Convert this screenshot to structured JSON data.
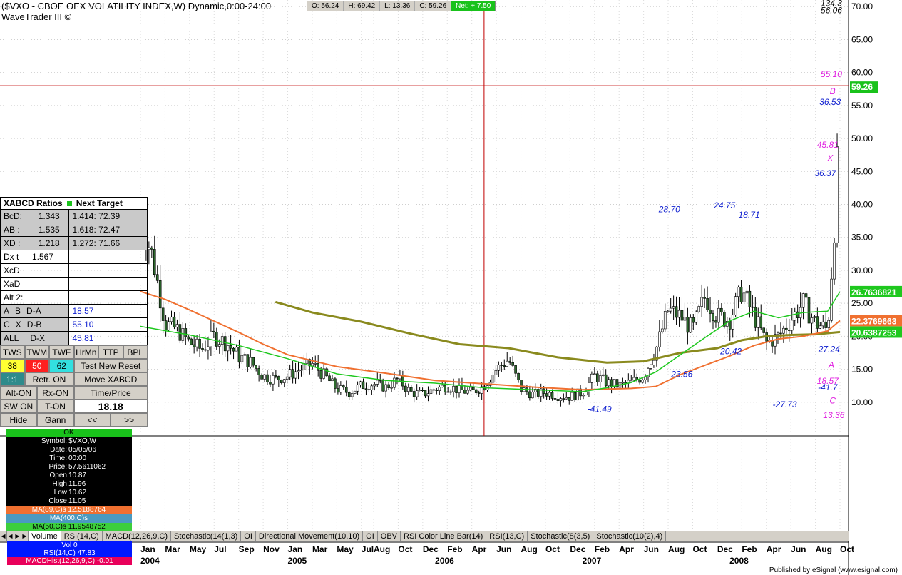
{
  "header": {
    "title": "($VXO - CBOE OEX VOLATILITY INDEX,W) Dynamic,0:00-24:00",
    "subtitle": "WaveTrader III ©",
    "ohlc": {
      "open": "O: 56.24",
      "high": "H: 69.42",
      "low": "L: 13.36",
      "close": "C: 59.26",
      "net": "Net: + 7.50"
    }
  },
  "colors": {
    "candle": "#000000",
    "ma_green": "#1ec81e",
    "ma_orange": "#f07030",
    "ma_olive": "#8a8a1e",
    "price_line": "#c00000",
    "label_blue": "#1020d0",
    "label_magenta": "#e020e0"
  },
  "chart_data": {
    "type": "candlestick",
    "y_ticks": [
      "70.00",
      "65.00",
      "60.00",
      "55.00",
      "50.00",
      "45.00",
      "40.00",
      "35.00",
      "30.00",
      "25.00",
      "20.00",
      "15.00",
      "10.00"
    ],
    "ylim": [
      5,
      71
    ],
    "x_month_labels": [
      {
        "t": 0,
        "label": "Jan"
      },
      {
        "t": 2,
        "label": "Mar"
      },
      {
        "t": 4,
        "label": "May"
      },
      {
        "t": 6,
        "label": "Jul"
      },
      {
        "t": 8,
        "label": "Sep"
      },
      {
        "t": 10,
        "label": "Nov"
      },
      {
        "t": 12,
        "label": "Jan"
      },
      {
        "t": 14,
        "label": "Mar"
      },
      {
        "t": 16,
        "label": "May"
      },
      {
        "t": 18,
        "label": "Jul"
      },
      {
        "t": 19,
        "label": "Aug"
      },
      {
        "t": 21,
        "label": "Oct"
      },
      {
        "t": 23,
        "label": "Dec"
      },
      {
        "t": 25,
        "label": "Feb"
      },
      {
        "t": 27,
        "label": "Apr"
      },
      {
        "t": 29,
        "label": "Jun"
      },
      {
        "t": 31,
        "label": "Aug"
      },
      {
        "t": 33,
        "label": "Oct"
      },
      {
        "t": 35,
        "label": "Dec"
      },
      {
        "t": 37,
        "label": "Feb"
      },
      {
        "t": 39,
        "label": "Apr"
      },
      {
        "t": 41,
        "label": "Jun"
      },
      {
        "t": 43,
        "label": "Aug"
      },
      {
        "t": 45,
        "label": "Oct"
      },
      {
        "t": 47,
        "label": "Dec"
      },
      {
        "t": 49,
        "label": "Feb"
      },
      {
        "t": 51,
        "label": "Apr"
      },
      {
        "t": 53,
        "label": "Jun"
      },
      {
        "t": 55,
        "label": "Aug"
      },
      {
        "t": 57,
        "label": "Oct"
      }
    ],
    "x_year_labels": [
      {
        "t": 0,
        "label": "2004"
      },
      {
        "t": 12,
        "label": "2005"
      },
      {
        "t": 24,
        "label": "2006"
      },
      {
        "t": 36,
        "label": "2007"
      },
      {
        "t": 48,
        "label": "2008"
      }
    ],
    "last_price": "59.26",
    "price_level": 58.0,
    "crosshair_t": 28,
    "ma_labels": [
      {
        "text": "26.7636821",
        "y": 26.76,
        "color": "#1ec81e"
      },
      {
        "text": "22.3769663",
        "y": 22.38,
        "color": "#f07030"
      },
      {
        "text": "20.6387253",
        "y": 20.64,
        "color": "#1ec81e"
      }
    ],
    "ma_green": [
      [
        0,
        21.5
      ],
      [
        4,
        20.2
      ],
      [
        8,
        18.6
      ],
      [
        12,
        16.6
      ],
      [
        16,
        14.3
      ],
      [
        20,
        13.3
      ],
      [
        24,
        12.9
      ],
      [
        28,
        12.2
      ],
      [
        32,
        11.9
      ],
      [
        36,
        11.6
      ],
      [
        38,
        12.2
      ],
      [
        40,
        13.0
      ],
      [
        42,
        14.6
      ],
      [
        44,
        17.2
      ],
      [
        46,
        19.8
      ],
      [
        48,
        22.3
      ],
      [
        50,
        23.8
      ],
      [
        52,
        22.8
      ],
      [
        54,
        23.6
      ],
      [
        56,
        23.8
      ],
      [
        57,
        26.76
      ]
    ],
    "ma_orange": [
      [
        0,
        26.8
      ],
      [
        2,
        25.6
      ],
      [
        4,
        24.0
      ],
      [
        6,
        22.3
      ],
      [
        8,
        20.6
      ],
      [
        10,
        18.8
      ],
      [
        12,
        17.2
      ],
      [
        16,
        15.4
      ],
      [
        20,
        14.4
      ],
      [
        24,
        13.3
      ],
      [
        28,
        12.8
      ],
      [
        32,
        12.3
      ],
      [
        36,
        11.9
      ],
      [
        40,
        12.1
      ],
      [
        42,
        12.4
      ],
      [
        44,
        14.2
      ],
      [
        46,
        15.6
      ],
      [
        48,
        17.0
      ],
      [
        50,
        18.6
      ],
      [
        52,
        19.6
      ],
      [
        54,
        20.0
      ],
      [
        56,
        20.8
      ],
      [
        57,
        22.38
      ]
    ],
    "ma_olive": [
      [
        11,
        25.2
      ],
      [
        14,
        23.6
      ],
      [
        18,
        22.2
      ],
      [
        22,
        20.4
      ],
      [
        26,
        18.8
      ],
      [
        30,
        18.2
      ],
      [
        34,
        16.8
      ],
      [
        38,
        16.0
      ],
      [
        41,
        16.2
      ],
      [
        44,
        17.5
      ],
      [
        47,
        18.2
      ],
      [
        49,
        19.4
      ],
      [
        51,
        20.0
      ],
      [
        53,
        20.2
      ],
      [
        55,
        20.3
      ],
      [
        57,
        20.64
      ]
    ],
    "candles_anchor": [
      [
        0,
        38
      ],
      [
        1,
        32
      ],
      [
        2,
        22
      ],
      [
        3,
        21
      ],
      [
        4,
        19
      ],
      [
        5,
        18
      ],
      [
        6,
        20
      ],
      [
        7,
        19
      ],
      [
        8,
        17
      ],
      [
        9,
        16
      ],
      [
        10,
        14
      ],
      [
        11,
        13.5
      ],
      [
        12,
        14
      ],
      [
        13,
        15
      ],
      [
        14,
        15.8
      ],
      [
        15,
        14
      ],
      [
        16,
        12
      ],
      [
        17,
        11.5
      ],
      [
        18,
        12.5
      ],
      [
        19,
        12.8
      ],
      [
        20,
        12.3
      ],
      [
        21,
        13.5
      ],
      [
        22,
        11.5
      ],
      [
        23,
        11.2
      ],
      [
        24,
        12
      ],
      [
        25,
        12.5
      ],
      [
        26,
        11.8
      ],
      [
        27,
        11.5
      ],
      [
        28,
        12.5
      ],
      [
        29,
        15
      ],
      [
        30,
        16.5
      ],
      [
        31,
        12
      ],
      [
        32,
        11.2
      ],
      [
        33,
        11.5
      ],
      [
        34,
        11
      ],
      [
        35,
        10.8
      ],
      [
        36,
        11.5
      ],
      [
        37,
        14
      ],
      [
        38,
        13
      ],
      [
        39,
        12.5
      ],
      [
        40,
        13
      ],
      [
        41,
        14
      ],
      [
        42,
        18
      ],
      [
        43,
        24
      ],
      [
        44,
        23
      ],
      [
        45,
        21
      ],
      [
        46,
        26
      ],
      [
        47,
        23
      ],
      [
        48,
        22.5
      ],
      [
        49,
        27
      ],
      [
        50,
        23
      ],
      [
        51,
        19
      ],
      [
        52,
        20
      ],
      [
        53,
        22.5
      ],
      [
        54,
        25
      ],
      [
        55,
        22
      ],
      [
        56,
        21
      ],
      [
        56.5,
        35
      ],
      [
        57,
        55
      ]
    ],
    "annotations": [
      {
        "t": 43.1,
        "y": 38.8,
        "text": "28.70",
        "color": "#1020d0"
      },
      {
        "t": 47.6,
        "y": 39.4,
        "text": "24.75",
        "color": "#1020d0"
      },
      {
        "t": 49.6,
        "y": 38.0,
        "text": "18.71",
        "color": "#1020d0"
      },
      {
        "t": 44.0,
        "y": 13.8,
        "text": "-23.56",
        "color": "#1020d0"
      },
      {
        "t": 48.0,
        "y": 17.3,
        "text": "-20.42",
        "color": "#1020d0"
      },
      {
        "t": 37.4,
        "y": 8.5,
        "text": "-41.49",
        "color": "#1020d0"
      },
      {
        "t": 52.5,
        "y": 9.2,
        "text": "-27.73",
        "color": "#1020d0"
      },
      {
        "t": 56.0,
        "y": 17.6,
        "text": "-27.24",
        "color": "#1020d0"
      },
      {
        "t": 56.0,
        "y": 11.8,
        "text": "-41.7",
        "color": "#1020d0"
      },
      {
        "t": 56.2,
        "y": 55.1,
        "text": "36.53",
        "color": "#1020d0"
      },
      {
        "t": 55.8,
        "y": 44.3,
        "text": "36.37",
        "color": "#1020d0"
      },
      {
        "t": 56.3,
        "y": 59.3,
        "text": "55.10",
        "color": "#e020e0"
      },
      {
        "t": 56.0,
        "y": 48.6,
        "text": "45.81",
        "color": "#e020e0"
      },
      {
        "t": 56.0,
        "y": 12.8,
        "text": "18.57",
        "color": "#e020e0"
      },
      {
        "t": 56.5,
        "y": 7.6,
        "text": "13.36",
        "color": "#e020e0"
      },
      {
        "t": 56.2,
        "y": 46.6,
        "text": "X",
        "color": "#e020e0"
      },
      {
        "t": 56.4,
        "y": 56.7,
        "text": "B",
        "color": "#e020e0"
      },
      {
        "t": 56.3,
        "y": 15.2,
        "text": "A",
        "color": "#e020e0"
      },
      {
        "t": 56.4,
        "y": 9.8,
        "text": "C",
        "color": "#e020e0"
      },
      {
        "t": 56.3,
        "y": 70.1,
        "text": "134.3",
        "color": "#000000"
      },
      {
        "t": 56.3,
        "y": 69.0,
        "text": "56.06",
        "color": "#000000"
      }
    ]
  },
  "xabcd": {
    "title": "XABCD Ratios",
    "next": "Next Target",
    "rows": [
      [
        "BcD:",
        "1.343",
        "1.414: 72.39"
      ],
      [
        "AB :",
        "1.535",
        "1.618: 72.47"
      ],
      [
        "XD :",
        "1.218",
        "1.272: 71.66"
      ],
      [
        "Dx t",
        "1.567",
        ""
      ],
      [
        "XcD",
        "",
        ""
      ],
      [
        "XaD",
        "",
        ""
      ],
      [
        "Alt 2:",
        "",
        ""
      ]
    ],
    "ab_rows": [
      {
        "a": "A",
        "b": "B",
        "c": "D-A",
        "v": "18.57"
      },
      {
        "a": "C",
        "b": "X",
        "c": "D-B",
        "v": "55.10"
      },
      {
        "a": "ALL",
        "b": "",
        "c": "D-X",
        "v": "45.81"
      }
    ],
    "buttons_row1": [
      "TWS",
      "TWM",
      "TWF",
      "HrMn",
      "TTP",
      "BPL"
    ],
    "buttons_row2": [
      "38",
      "50",
      "62",
      "Test New",
      "Reset"
    ],
    "buttons_row3": [
      "1:1",
      "Retr. ON",
      "Move XABCD"
    ],
    "buttons_row4": [
      "Alt-ON",
      "Rx-ON",
      "Time/Price"
    ],
    "buttons_row5": [
      "SW ON",
      "T-ON",
      "18.18"
    ],
    "buttons_row6": [
      "Hide",
      "Gann",
      "<<",
      ">>"
    ]
  },
  "data_window": {
    "status": "OK",
    "rows": [
      [
        "Symbol:",
        "$VXO,W"
      ],
      [
        "Date:",
        "05/05/06"
      ],
      [
        "Time:",
        "00:00"
      ],
      [
        "Price:",
        "57.5611062"
      ],
      [
        "Open",
        "10.87"
      ],
      [
        "High",
        "11.96"
      ],
      [
        "Low",
        "10.62"
      ],
      [
        "Close",
        "11.05"
      ]
    ],
    "ma1": "MA(89,C)s 12.5188764",
    "ma2": "MA(400,C)s",
    "ma3": "MA(50,C)s 11.9548752"
  },
  "tabs": [
    "Volume",
    "RSI(14,C)",
    "MACD(12,26,9,C)",
    "Stochastic(14(1,3)",
    "OI",
    "Directional Movement(10,10)",
    "OI",
    "OBV",
    "RSI Color Line Bar(14)",
    "RSI(13,C)",
    "Stochastic(8(3,5)",
    "Stochastic(10(2),4)"
  ],
  "bottom_box": {
    "vol": "Vol 0",
    "rsi": "RSI(14,C) 47.83",
    "macd": "MACDHist(12,26,9,C) -0.01"
  },
  "footer": "Published by eSignal (www.esignal.com)"
}
